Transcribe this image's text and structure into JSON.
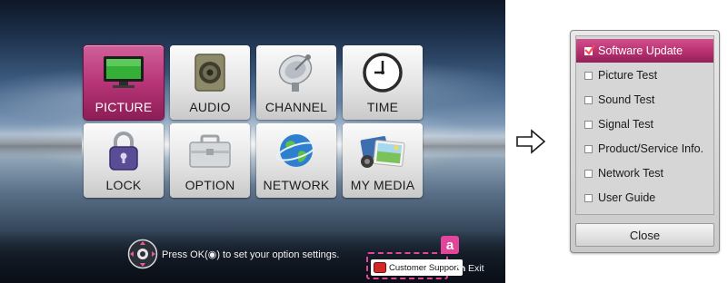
{
  "home_menu": {
    "tiles": [
      {
        "label": "PICTURE",
        "icon": "tv-monitor-icon",
        "selected": true
      },
      {
        "label": "AUDIO",
        "icon": "speaker-icon",
        "selected": false
      },
      {
        "label": "CHANNEL",
        "icon": "satellite-dish-icon",
        "selected": false
      },
      {
        "label": "TIME",
        "icon": "clock-icon",
        "selected": false
      },
      {
        "label": "LOCK",
        "icon": "padlock-icon",
        "selected": false
      },
      {
        "label": "OPTION",
        "icon": "toolbox-icon",
        "selected": false
      },
      {
        "label": "NETWORK",
        "icon": "globe-icon",
        "selected": false
      },
      {
        "label": "MY MEDIA",
        "icon": "media-photos-icon",
        "selected": false
      }
    ],
    "hint": "Press OK(◉) to set your option settings.",
    "customer_support_label": "Customer Support",
    "callout_label": "a",
    "exit_label": "Exit"
  },
  "support_menu": {
    "items": [
      {
        "label": "Software Update",
        "selected": true
      },
      {
        "label": "Picture Test",
        "selected": false
      },
      {
        "label": "Sound Test",
        "selected": false
      },
      {
        "label": "Signal Test",
        "selected": false
      },
      {
        "label": "Product/Service Info.",
        "selected": false
      },
      {
        "label": "Network Test",
        "selected": false
      },
      {
        "label": "User Guide",
        "selected": false
      }
    ],
    "close_label": "Close"
  },
  "colors": {
    "accent": "#b83577",
    "callout": "#e2469a"
  }
}
